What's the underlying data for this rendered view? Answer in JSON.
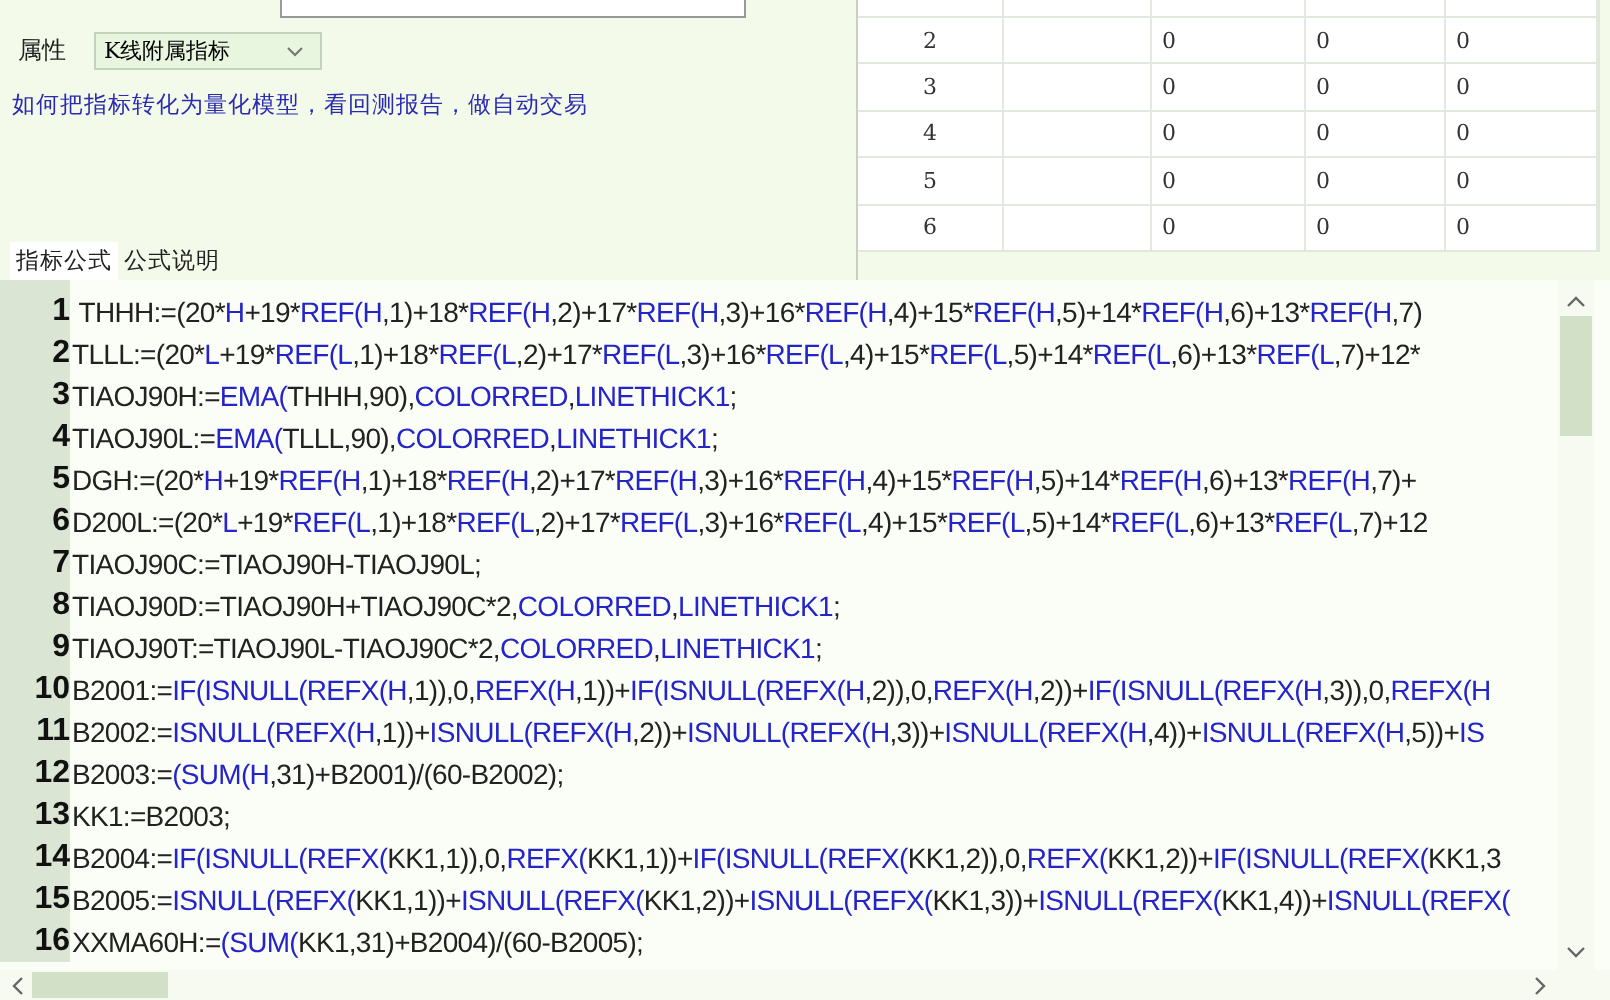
{
  "attribute": {
    "label": "属性",
    "value": "K线附属指标"
  },
  "link": "如何把指标转化为量化模型，看回测报告，做自动交易",
  "table": {
    "rows": [
      {
        "cells": [
          "2",
          "",
          "0",
          "0",
          "0"
        ]
      },
      {
        "cells": [
          "3",
          "",
          "0",
          "0",
          "0"
        ]
      },
      {
        "cells": [
          "4",
          "",
          "0",
          "0",
          "0"
        ]
      },
      {
        "cells": [
          "5",
          "",
          "0",
          "0",
          "0"
        ]
      },
      {
        "cells": [
          "6",
          "",
          "0",
          "0",
          "0"
        ]
      }
    ]
  },
  "tabs": [
    {
      "label": "指标公式",
      "selected": true
    },
    {
      "label": "公式说明",
      "selected": false
    }
  ],
  "code_lines": [
    {
      "number": "1",
      "segments": [
        " THHH:=(20*",
        "H",
        "+19*",
        "REF(H",
        ",1)+18*",
        "REF(H",
        ",2)+17*",
        "REF(H",
        ",3)+16*",
        "REF(H",
        ",4)+15*",
        "REF(H",
        ",5)+14*",
        "REF(H",
        ",6)+13*",
        "REF(H",
        ",7)"
      ]
    },
    {
      "number": "2",
      "segments": [
        "TLLL:=(20*",
        "L",
        "+19*",
        "REF(L",
        ",1)+18*",
        "REF(L",
        ",2)+17*",
        "REF(L",
        ",3)+16*",
        "REF(L",
        ",4)+15*",
        "REF(L",
        ",5)+14*",
        "REF(L",
        ",6)+13*",
        "REF(L",
        ",7)+12*"
      ]
    },
    {
      "number": "3",
      "segments": [
        "TIAOJ90H:=",
        "EMA(",
        "THHH,90),",
        "COLORRED",
        ",",
        "LINETHICK1",
        ";"
      ]
    },
    {
      "number": "4",
      "segments": [
        "TIAOJ90L:=",
        "EMA(",
        "TLLL,90),",
        "COLORRED",
        ",",
        "LINETHICK1",
        ";"
      ]
    },
    {
      "number": "5",
      "segments": [
        "DGH:=(20*",
        "H",
        "+19*",
        "REF(H",
        ",1)+18*",
        "REF(H",
        ",2)+17*",
        "REF(H",
        ",3)+16*",
        "REF(H",
        ",4)+15*",
        "REF(H",
        ",5)+14*",
        "REF(H",
        ",6)+13*",
        "REF(H",
        ",7)+"
      ]
    },
    {
      "number": "6",
      "segments": [
        "D200L:=(20*",
        "L",
        "+19*",
        "REF(L",
        ",1)+18*",
        "REF(L",
        ",2)+17*",
        "REF(L",
        ",3)+16*",
        "REF(L",
        ",4)+15*",
        "REF(L",
        ",5)+14*",
        "REF(L",
        ",6)+13*",
        "REF(L",
        ",7)+12"
      ]
    },
    {
      "number": "7",
      "segments": [
        "TIAOJ90C:=TIAOJ90H-TIAOJ90L;"
      ]
    },
    {
      "number": "8",
      "segments": [
        "TIAOJ90D:=TIAOJ90H+TIAOJ90C*2,",
        "COLORRED",
        ",",
        "LINETHICK1",
        ";"
      ]
    },
    {
      "number": "9",
      "segments": [
        "TIAOJ90T:=TIAOJ90L-TIAOJ90C*2,",
        "COLORRED",
        ",",
        "LINETHICK1",
        ";"
      ]
    },
    {
      "number": "10",
      "segments": [
        "B2001:=",
        "IF(ISNULL(REFX(H",
        ",1)),0,",
        "REFX(H",
        ",1))+",
        "IF(ISNULL(REFX(H",
        ",2)),0,",
        "REFX(H",
        ",2))+",
        "IF(ISNULL(REFX(H",
        ",3)),0,",
        "REFX(H"
      ]
    },
    {
      "number": "11",
      "segments": [
        "B2002:=",
        "ISNULL(REFX(H",
        ",1))+",
        "ISNULL(REFX(H",
        ",2))+",
        "ISNULL(REFX(H",
        ",3))+",
        "ISNULL(REFX(H",
        ",4))+",
        "ISNULL(REFX(H",
        ",5))+",
        "IS"
      ]
    },
    {
      "number": "12",
      "segments": [
        "B2003:=",
        "(SUM(H",
        ",31)+B2001)/(60-B2002);"
      ]
    },
    {
      "number": "13",
      "segments": [
        "KK1:=B2003;"
      ]
    },
    {
      "number": "14",
      "segments": [
        "B2004:=",
        "IF(ISNULL(REFX(",
        "KK1,1)),0,",
        "REFX(",
        "KK1,1))+",
        "IF(ISNULL(REFX(",
        "KK1,2)),0,",
        "REFX(",
        "KK1,2))+",
        "IF(ISNULL(REFX(",
        "KK1,3"
      ]
    },
    {
      "number": "15",
      "segments": [
        "B2005:=",
        "ISNULL(REFX(",
        "KK1,1))+",
        "ISNULL(REFX(",
        "KK1,2))+",
        "ISNULL(REFX(",
        "KK1,3))+",
        "ISNULL(REFX(",
        "KK1,4))+",
        "ISNULL(REFX("
      ]
    },
    {
      "number": "16",
      "segments": [
        "XXMA60H:=",
        "(SUM(",
        "KK1,31)+B2004)/(60-B2005);"
      ]
    }
  ]
}
